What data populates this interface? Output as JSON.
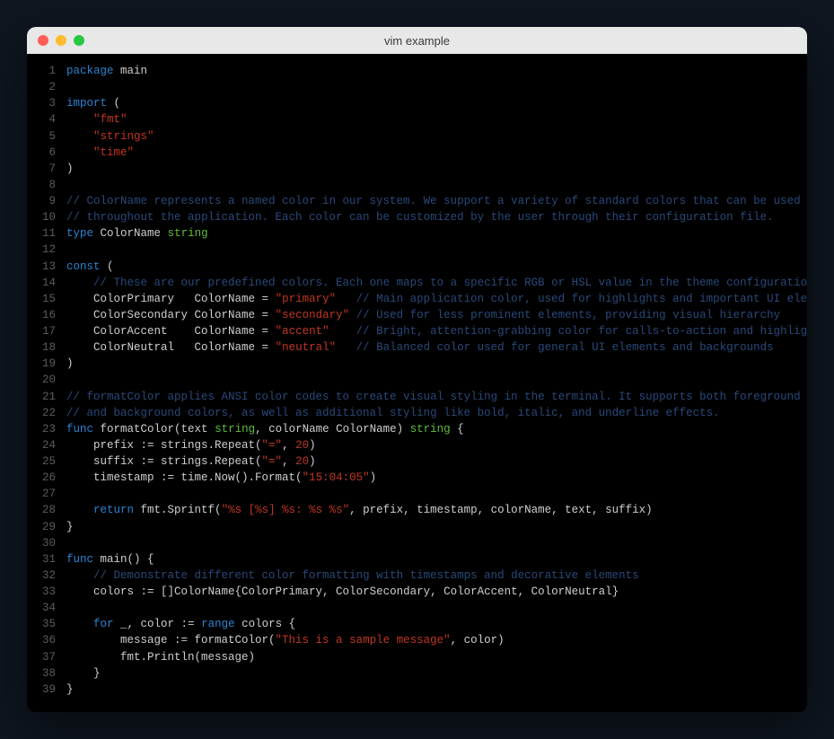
{
  "window": {
    "title": "vim example"
  },
  "colors": {
    "keyword": "#2a84d2",
    "type": "#5fbd3a",
    "string": "#c23621",
    "comment": "#29497a",
    "text": "#cfcfcf",
    "gutter": "#5c5c5c",
    "bg": "#000000"
  },
  "code": {
    "lines": [
      {
        "n": 1,
        "t": [
          [
            "kw",
            "package"
          ],
          [
            "sp",
            " "
          ],
          [
            "ident",
            "main"
          ]
        ]
      },
      {
        "n": 2,
        "t": []
      },
      {
        "n": 3,
        "t": [
          [
            "kw",
            "import"
          ],
          [
            "sp",
            " "
          ],
          [
            "punc",
            "("
          ]
        ]
      },
      {
        "n": 4,
        "t": [
          [
            "sp",
            "    "
          ],
          [
            "str",
            "\"fmt\""
          ]
        ]
      },
      {
        "n": 5,
        "t": [
          [
            "sp",
            "    "
          ],
          [
            "str",
            "\"strings\""
          ]
        ]
      },
      {
        "n": 6,
        "t": [
          [
            "sp",
            "    "
          ],
          [
            "str",
            "\"time\""
          ]
        ]
      },
      {
        "n": 7,
        "t": [
          [
            "punc",
            ")"
          ]
        ]
      },
      {
        "n": 8,
        "t": []
      },
      {
        "n": 9,
        "t": [
          [
            "cmt",
            "// ColorName represents a named color in our system. We support a variety of standard colors that can be used"
          ]
        ]
      },
      {
        "n": 10,
        "t": [
          [
            "cmt",
            "// throughout the application. Each color can be customized by the user through their configuration file."
          ]
        ]
      },
      {
        "n": 11,
        "t": [
          [
            "kw",
            "type"
          ],
          [
            "sp",
            " "
          ],
          [
            "ident",
            "ColorName"
          ],
          [
            "sp",
            " "
          ],
          [
            "type",
            "string"
          ]
        ]
      },
      {
        "n": 12,
        "t": []
      },
      {
        "n": 13,
        "t": [
          [
            "kw",
            "const"
          ],
          [
            "sp",
            " "
          ],
          [
            "punc",
            "("
          ]
        ]
      },
      {
        "n": 14,
        "t": [
          [
            "sp",
            "    "
          ],
          [
            "cmt",
            "// These are our predefined colors. Each one maps to a specific RGB or HSL value in the theme configuration."
          ]
        ]
      },
      {
        "n": 15,
        "t": [
          [
            "sp",
            "    "
          ],
          [
            "ident",
            "ColorPrimary   ColorName = "
          ],
          [
            "str",
            "\"primary\""
          ],
          [
            "sp",
            "   "
          ],
          [
            "cmt",
            "// Main application color, used for highlights and important UI elements"
          ]
        ]
      },
      {
        "n": 16,
        "t": [
          [
            "sp",
            "    "
          ],
          [
            "ident",
            "ColorSecondary ColorName = "
          ],
          [
            "str",
            "\"secondary\""
          ],
          [
            "sp",
            " "
          ],
          [
            "cmt",
            "// Used for less prominent elements, providing visual hierarchy"
          ]
        ]
      },
      {
        "n": 17,
        "t": [
          [
            "sp",
            "    "
          ],
          [
            "ident",
            "ColorAccent    ColorName = "
          ],
          [
            "str",
            "\"accent\""
          ],
          [
            "sp",
            "    "
          ],
          [
            "cmt",
            "// Bright, attention-grabbing color for calls-to-action and highlights"
          ]
        ]
      },
      {
        "n": 18,
        "t": [
          [
            "sp",
            "    "
          ],
          [
            "ident",
            "ColorNeutral   ColorName = "
          ],
          [
            "str",
            "\"neutral\""
          ],
          [
            "sp",
            "   "
          ],
          [
            "cmt",
            "// Balanced color used for general UI elements and backgrounds"
          ]
        ]
      },
      {
        "n": 19,
        "t": [
          [
            "punc",
            ")"
          ]
        ]
      },
      {
        "n": 20,
        "t": []
      },
      {
        "n": 21,
        "t": [
          [
            "cmt",
            "// formatColor applies ANSI color codes to create visual styling in the terminal. It supports both foreground"
          ]
        ]
      },
      {
        "n": 22,
        "t": [
          [
            "cmt",
            "// and background colors, as well as additional styling like bold, italic, and underline effects."
          ]
        ]
      },
      {
        "n": 23,
        "t": [
          [
            "kw",
            "func"
          ],
          [
            "sp",
            " "
          ],
          [
            "ident",
            "formatColor(text "
          ],
          [
            "type",
            "string"
          ],
          [
            "ident",
            ", colorName ColorName) "
          ],
          [
            "type",
            "string"
          ],
          [
            "sp",
            " "
          ],
          [
            "punc",
            "{"
          ]
        ]
      },
      {
        "n": 24,
        "t": [
          [
            "sp",
            "    "
          ],
          [
            "ident",
            "prefix := strings.Repeat("
          ],
          [
            "str",
            "\"=\""
          ],
          [
            "ident",
            ", "
          ],
          [
            "num",
            "20"
          ],
          [
            "ident",
            ")"
          ]
        ]
      },
      {
        "n": 25,
        "t": [
          [
            "sp",
            "    "
          ],
          [
            "ident",
            "suffix := strings.Repeat("
          ],
          [
            "str",
            "\"=\""
          ],
          [
            "ident",
            ", "
          ],
          [
            "num",
            "20"
          ],
          [
            "ident",
            ")"
          ]
        ]
      },
      {
        "n": 26,
        "t": [
          [
            "sp",
            "    "
          ],
          [
            "ident",
            "timestamp := time.Now().Format("
          ],
          [
            "str",
            "\"15:04:05\""
          ],
          [
            "ident",
            ")"
          ]
        ]
      },
      {
        "n": 27,
        "t": []
      },
      {
        "n": 28,
        "t": [
          [
            "sp",
            "    "
          ],
          [
            "kw",
            "return"
          ],
          [
            "sp",
            " "
          ],
          [
            "ident",
            "fmt.Sprintf("
          ],
          [
            "str",
            "\"%s [%s] %s: %s %s\""
          ],
          [
            "ident",
            ", prefix, timestamp, colorName, text, suffix)"
          ]
        ]
      },
      {
        "n": 29,
        "t": [
          [
            "punc",
            "}"
          ]
        ]
      },
      {
        "n": 30,
        "t": []
      },
      {
        "n": 31,
        "t": [
          [
            "kw",
            "func"
          ],
          [
            "sp",
            " "
          ],
          [
            "ident",
            "main() {"
          ]
        ]
      },
      {
        "n": 32,
        "t": [
          [
            "sp",
            "    "
          ],
          [
            "cmt",
            "// Demonstrate different color formatting with timestamps and decorative elements"
          ]
        ]
      },
      {
        "n": 33,
        "t": [
          [
            "sp",
            "    "
          ],
          [
            "ident",
            "colors := []ColorName{ColorPrimary, ColorSecondary, ColorAccent, ColorNeutral}"
          ]
        ]
      },
      {
        "n": 34,
        "t": []
      },
      {
        "n": 35,
        "t": [
          [
            "sp",
            "    "
          ],
          [
            "kw",
            "for"
          ],
          [
            "sp",
            " "
          ],
          [
            "ident",
            "_, color := "
          ],
          [
            "kw",
            "range"
          ],
          [
            "sp",
            " "
          ],
          [
            "ident",
            "colors {"
          ]
        ]
      },
      {
        "n": 36,
        "t": [
          [
            "sp",
            "        "
          ],
          [
            "ident",
            "message := formatColor("
          ],
          [
            "str",
            "\"This is a sample message\""
          ],
          [
            "ident",
            ", color)"
          ]
        ]
      },
      {
        "n": 37,
        "t": [
          [
            "sp",
            "        "
          ],
          [
            "ident",
            "fmt.Println(message)"
          ]
        ]
      },
      {
        "n": 38,
        "t": [
          [
            "sp",
            "    "
          ],
          [
            "punc",
            "}"
          ]
        ]
      },
      {
        "n": 39,
        "t": [
          [
            "punc",
            "}"
          ]
        ]
      }
    ]
  }
}
